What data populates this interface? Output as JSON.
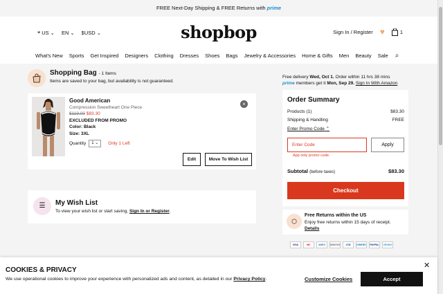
{
  "promo_bar": {
    "text": "FREE Next-Day Shipping & FREE Returns with",
    "prime": "prime"
  },
  "header": {
    "country": "US",
    "language": "EN",
    "currency": "$USD",
    "logo": "shopbop",
    "sign_in": "Sign In / Register",
    "bag_count": "1"
  },
  "nav": [
    "What's New",
    "Sports",
    "Get Inspired",
    "Designers",
    "Clothing",
    "Dresses",
    "Shoes",
    "Bags",
    "Jewelry & Accessories",
    "Home & Gifts",
    "Men",
    "Beauty",
    "Sale"
  ],
  "bag": {
    "title": "Shopping Bag",
    "count": "- 1 Items",
    "subtitle": "Items are saved to your bag, but availability is not guaranteed.",
    "item": {
      "brand": "Good American",
      "name": "Compression Sweetheart One Piece",
      "old_price": "$119.00",
      "new_price": "$83.30",
      "promo": "EXCLUDED FROM PROMO",
      "color": "Color: Black",
      "size": "Size: 3XL",
      "qty_label": "Quantity",
      "qty": "1",
      "stock": "Only 1 Left",
      "edit": "Edit",
      "move": "Move To Wish List"
    }
  },
  "wishlist": {
    "title": "My Wish List",
    "text": "To view your wish list or start saving,",
    "link": "Sign In or Register"
  },
  "delivery": {
    "line1_a": "Free delivery",
    "line1_b": "Wed, Oct 1.",
    "line1_c": "Order within 11 hrs 38 mins",
    "prime": "prime",
    "line2_a": "members get it",
    "line2_b": "Mon, Sep 29.",
    "line2_link": "Sign In With Amazon"
  },
  "summary": {
    "title": "Order Summary",
    "products_label": "Products (1)",
    "products_value": "$83.30",
    "shipping_label": "Shipping & Handling",
    "shipping_value": "FREE",
    "promo_link": "Enter Promo Code",
    "promo_placeholder": "Enter Code",
    "apply": "Apply",
    "promo_error": "App only promo code.",
    "subtotal_label": "Subtotal",
    "subtotal_note": "(before taxes)",
    "subtotal_value": "$83.30",
    "checkout": "Checkout"
  },
  "returns": {
    "title": "Free Returns within the US",
    "text": "Enjoy free returns within 15 days of receipt.",
    "link": "Details"
  },
  "payment_cards": [
    "VISA",
    "MC",
    "AMEX",
    "DISCOVER",
    "JCB",
    "DINERS",
    "PAYPAL",
    "VENMO"
  ],
  "cookie": {
    "title": "COOKIES & PRIVACY",
    "text": "We use operational cookies to improve your experience with personalized ads and content, as detailed in our",
    "policy": "Privacy Policy",
    "customize": "Customize Cookies",
    "accept": "Accept"
  },
  "colors": {
    "accent": "#d9381e",
    "prime": "#1a8fd1",
    "peach": "#f9e0cf"
  }
}
